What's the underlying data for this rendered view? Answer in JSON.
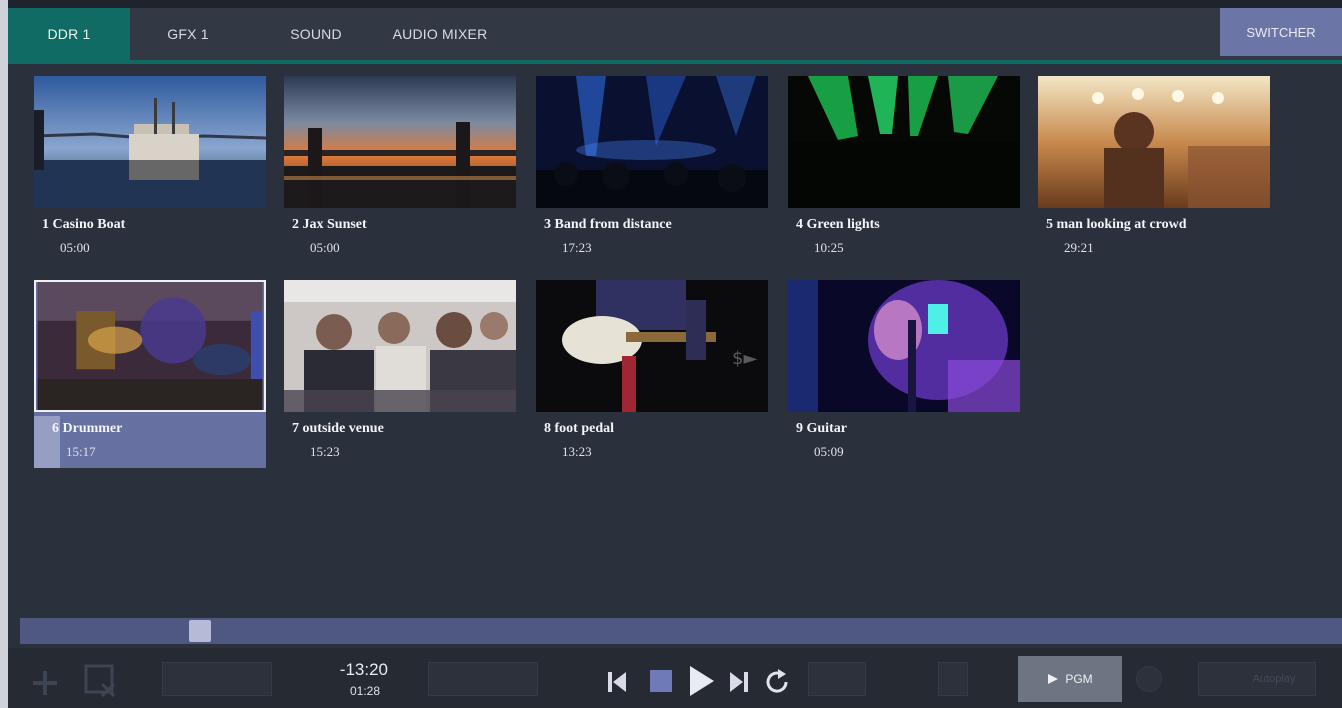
{
  "tabs": [
    {
      "label": "DDR 1"
    },
    {
      "label": "GFX 1"
    },
    {
      "label": "SOUND"
    },
    {
      "label": "AUDIO MIXER"
    }
  ],
  "switcher_label": "SWITCHER",
  "clips": [
    {
      "title": "1 Casino Boat",
      "duration": "05:00"
    },
    {
      "title": "2 Jax Sunset",
      "duration": "05:00"
    },
    {
      "title": "3 Band from distance",
      "duration": "17:23"
    },
    {
      "title": "4 Green lights",
      "duration": "10:25"
    },
    {
      "title": "5 man looking at crowd",
      "duration": "29:21"
    },
    {
      "title": "6 Drummer",
      "duration": "15:17"
    },
    {
      "title": "7 outside venue",
      "duration": "15:23"
    },
    {
      "title": "8 foot pedal",
      "duration": "13:23"
    },
    {
      "title": "9 Guitar",
      "duration": "05:09"
    }
  ],
  "selected_clip": 6,
  "playhead_fraction": 0.13,
  "transport": {
    "remaining": "-13:20",
    "elapsed": "01:28",
    "pgm_label": "PGM",
    "autoplay_label": "Autoplay"
  },
  "colors": {
    "active_tab": "#0f6b63",
    "switcher": "#6b76a6",
    "selection": "#6670a1",
    "scrub": "#4f5880"
  },
  "icons": [
    "add-icon",
    "remove-icon",
    "skip-back-icon",
    "stop-icon",
    "play-icon",
    "skip-forward-icon",
    "loop-icon",
    "play-pgm-icon"
  ]
}
